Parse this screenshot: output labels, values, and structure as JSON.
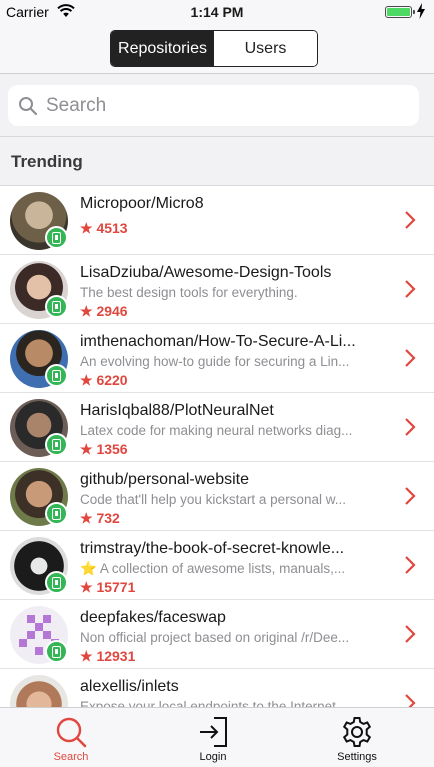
{
  "status_bar": {
    "carrier": "Carrier",
    "time": "1:14 PM"
  },
  "segmented": {
    "left_label": "Repositories",
    "right_label": "Users",
    "selected": "Repositories"
  },
  "search": {
    "placeholder": "Search"
  },
  "section": {
    "title": "Trending"
  },
  "repos": [
    {
      "name": "Micropoor/Micro8",
      "description": "",
      "stars": "★ 4513"
    },
    {
      "name": "LisaDziuba/Awesome-Design-Tools",
      "description": "The best design tools for everything.",
      "stars": "★ 2946"
    },
    {
      "name": "imthenachoman/How-To-Secure-A-Li...",
      "description": "An evolving how-to guide for securing a Lin...",
      "stars": "★ 6220"
    },
    {
      "name": "HarisIqbal88/PlotNeuralNet",
      "description": "Latex code for making neural networks diag...",
      "stars": "★ 1356"
    },
    {
      "name": "github/personal-website",
      "description": "Code that'll help you kickstart a personal w...",
      "stars": "★ 732"
    },
    {
      "name": "trimstray/the-book-of-secret-knowle...",
      "description": "⭐ A collection of awesome lists, manuals,...",
      "stars": "★ 15771"
    },
    {
      "name": "deepfakes/faceswap",
      "description": "Non official project based on original /r/Dee...",
      "stars": "★ 12931"
    },
    {
      "name": "alexellis/inlets",
      "description": "Expose your local endpoints to the Internet",
      "stars": ""
    }
  ],
  "tabs": [
    {
      "label": "Search",
      "icon": "search-icon",
      "active": true
    },
    {
      "label": "Login",
      "icon": "login-icon",
      "active": false
    },
    {
      "label": "Settings",
      "icon": "gear-icon",
      "active": false
    }
  ],
  "colors": {
    "accent": "#e0473f",
    "badge": "#34b556",
    "segment_active": "#222222"
  }
}
